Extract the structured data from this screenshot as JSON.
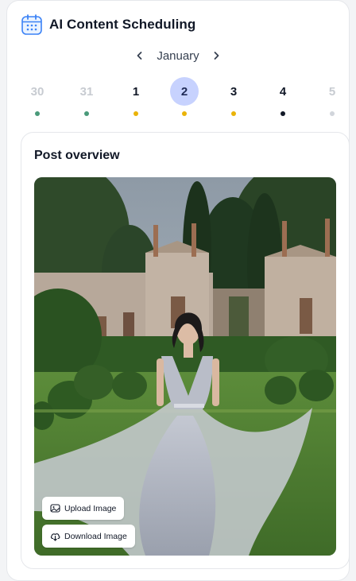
{
  "app": {
    "title": "AI Content Scheduling"
  },
  "calendar": {
    "month": "January",
    "days": [
      {
        "day": "30",
        "dot_color": "#4a9a7a",
        "muted": true,
        "selected": false
      },
      {
        "day": "31",
        "dot_color": "#4a9a7a",
        "muted": true,
        "selected": false
      },
      {
        "day": "1",
        "dot_color": "#eab308",
        "muted": false,
        "selected": false
      },
      {
        "day": "2",
        "dot_color": "#eab308",
        "muted": false,
        "selected": true
      },
      {
        "day": "3",
        "dot_color": "#eab308",
        "muted": false,
        "selected": false
      },
      {
        "day": "4",
        "dot_color": "#111827",
        "muted": false,
        "selected": false
      },
      {
        "day": "5",
        "dot_color": "#d1d5db",
        "muted": true,
        "selected": false
      }
    ]
  },
  "post_overview": {
    "title": "Post overview",
    "upload_label": "Upload Image",
    "download_label": "Download Image"
  },
  "colors": {
    "accent": "#3b82f6",
    "selected_day_bg": "#c7d2fe"
  }
}
